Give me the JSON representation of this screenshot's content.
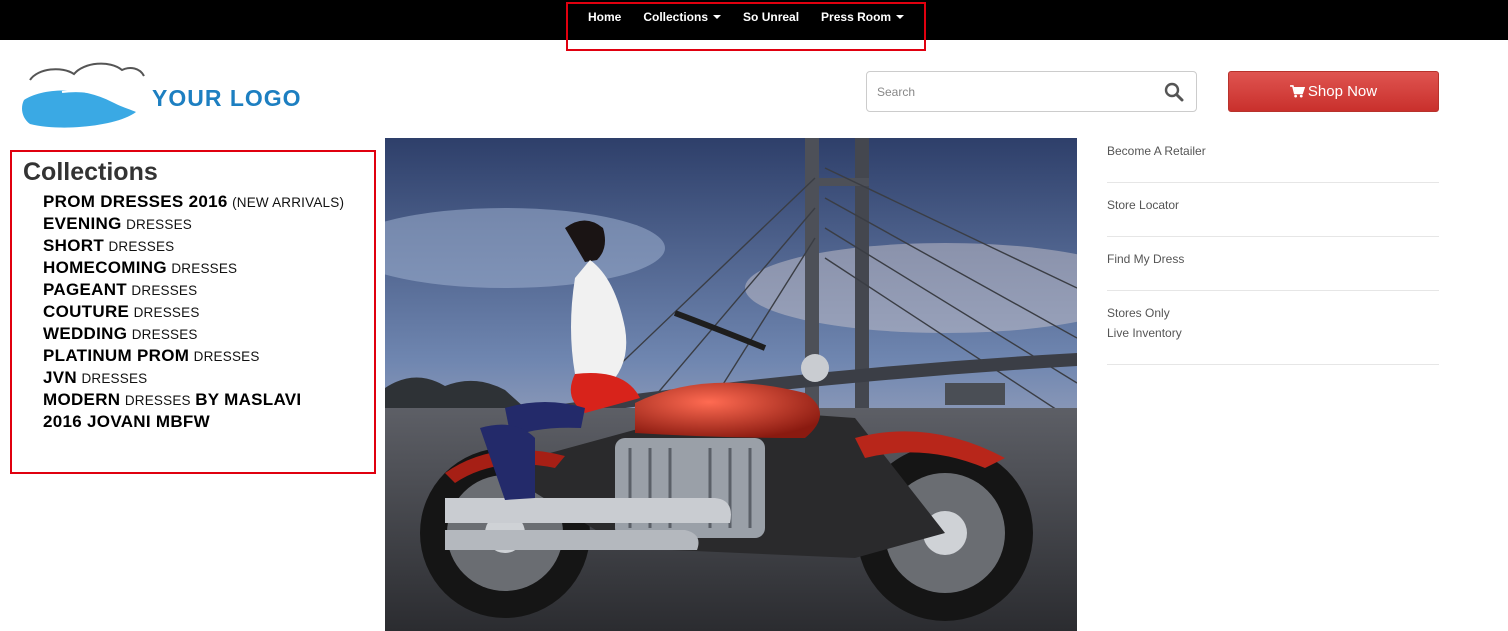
{
  "nav": {
    "items": [
      {
        "label": "Home",
        "dropdown": false
      },
      {
        "label": "Collections",
        "dropdown": true
      },
      {
        "label": "So Unreal",
        "dropdown": false
      },
      {
        "label": "Press Room",
        "dropdown": true
      }
    ]
  },
  "header": {
    "logo_text": "YOUR LOGO",
    "search_placeholder": "Search",
    "shop_now_label": "Shop Now"
  },
  "collections": {
    "title": "Collections",
    "items": [
      {
        "strong": "PROM DRESSES 2016",
        "light": "(NEW ARRIVALS)"
      },
      {
        "strong": "EVENING",
        "light": "DRESSES"
      },
      {
        "strong": "SHORT",
        "light": "DRESSES"
      },
      {
        "strong": "HOMECOMING",
        "light": "DRESSES"
      },
      {
        "strong": "PAGEANT",
        "light": "DRESSES"
      },
      {
        "strong": "COUTURE",
        "light": "DRESSES"
      },
      {
        "strong": "WEDDING",
        "light": "DRESSES"
      },
      {
        "strong": "PLATINUM PROM",
        "light": "DRESSES"
      },
      {
        "strong": "JVN",
        "light": "DRESSES"
      },
      {
        "strong": "MODERN",
        "light": "DRESSES",
        "suffix": "BY MASLAVI"
      },
      {
        "strong": "2016 JOVANI MBFW",
        "light": ""
      }
    ]
  },
  "right_links": [
    {
      "line1": "Become A Retailer",
      "line2": ""
    },
    {
      "line1": "Store Locator",
      "line2": ""
    },
    {
      "line1": "Find My Dress",
      "line2": ""
    },
    {
      "line1": "Stores Only",
      "line2": "Live Inventory"
    }
  ],
  "colors": {
    "topbar": "#000000",
    "highlight": "#e0000f",
    "logo_blue": "#1d7fc1",
    "shop_button": "#d9534f"
  },
  "icons": {
    "search": "search-icon",
    "cart": "cart-icon",
    "caret": "caret-down-icon"
  }
}
